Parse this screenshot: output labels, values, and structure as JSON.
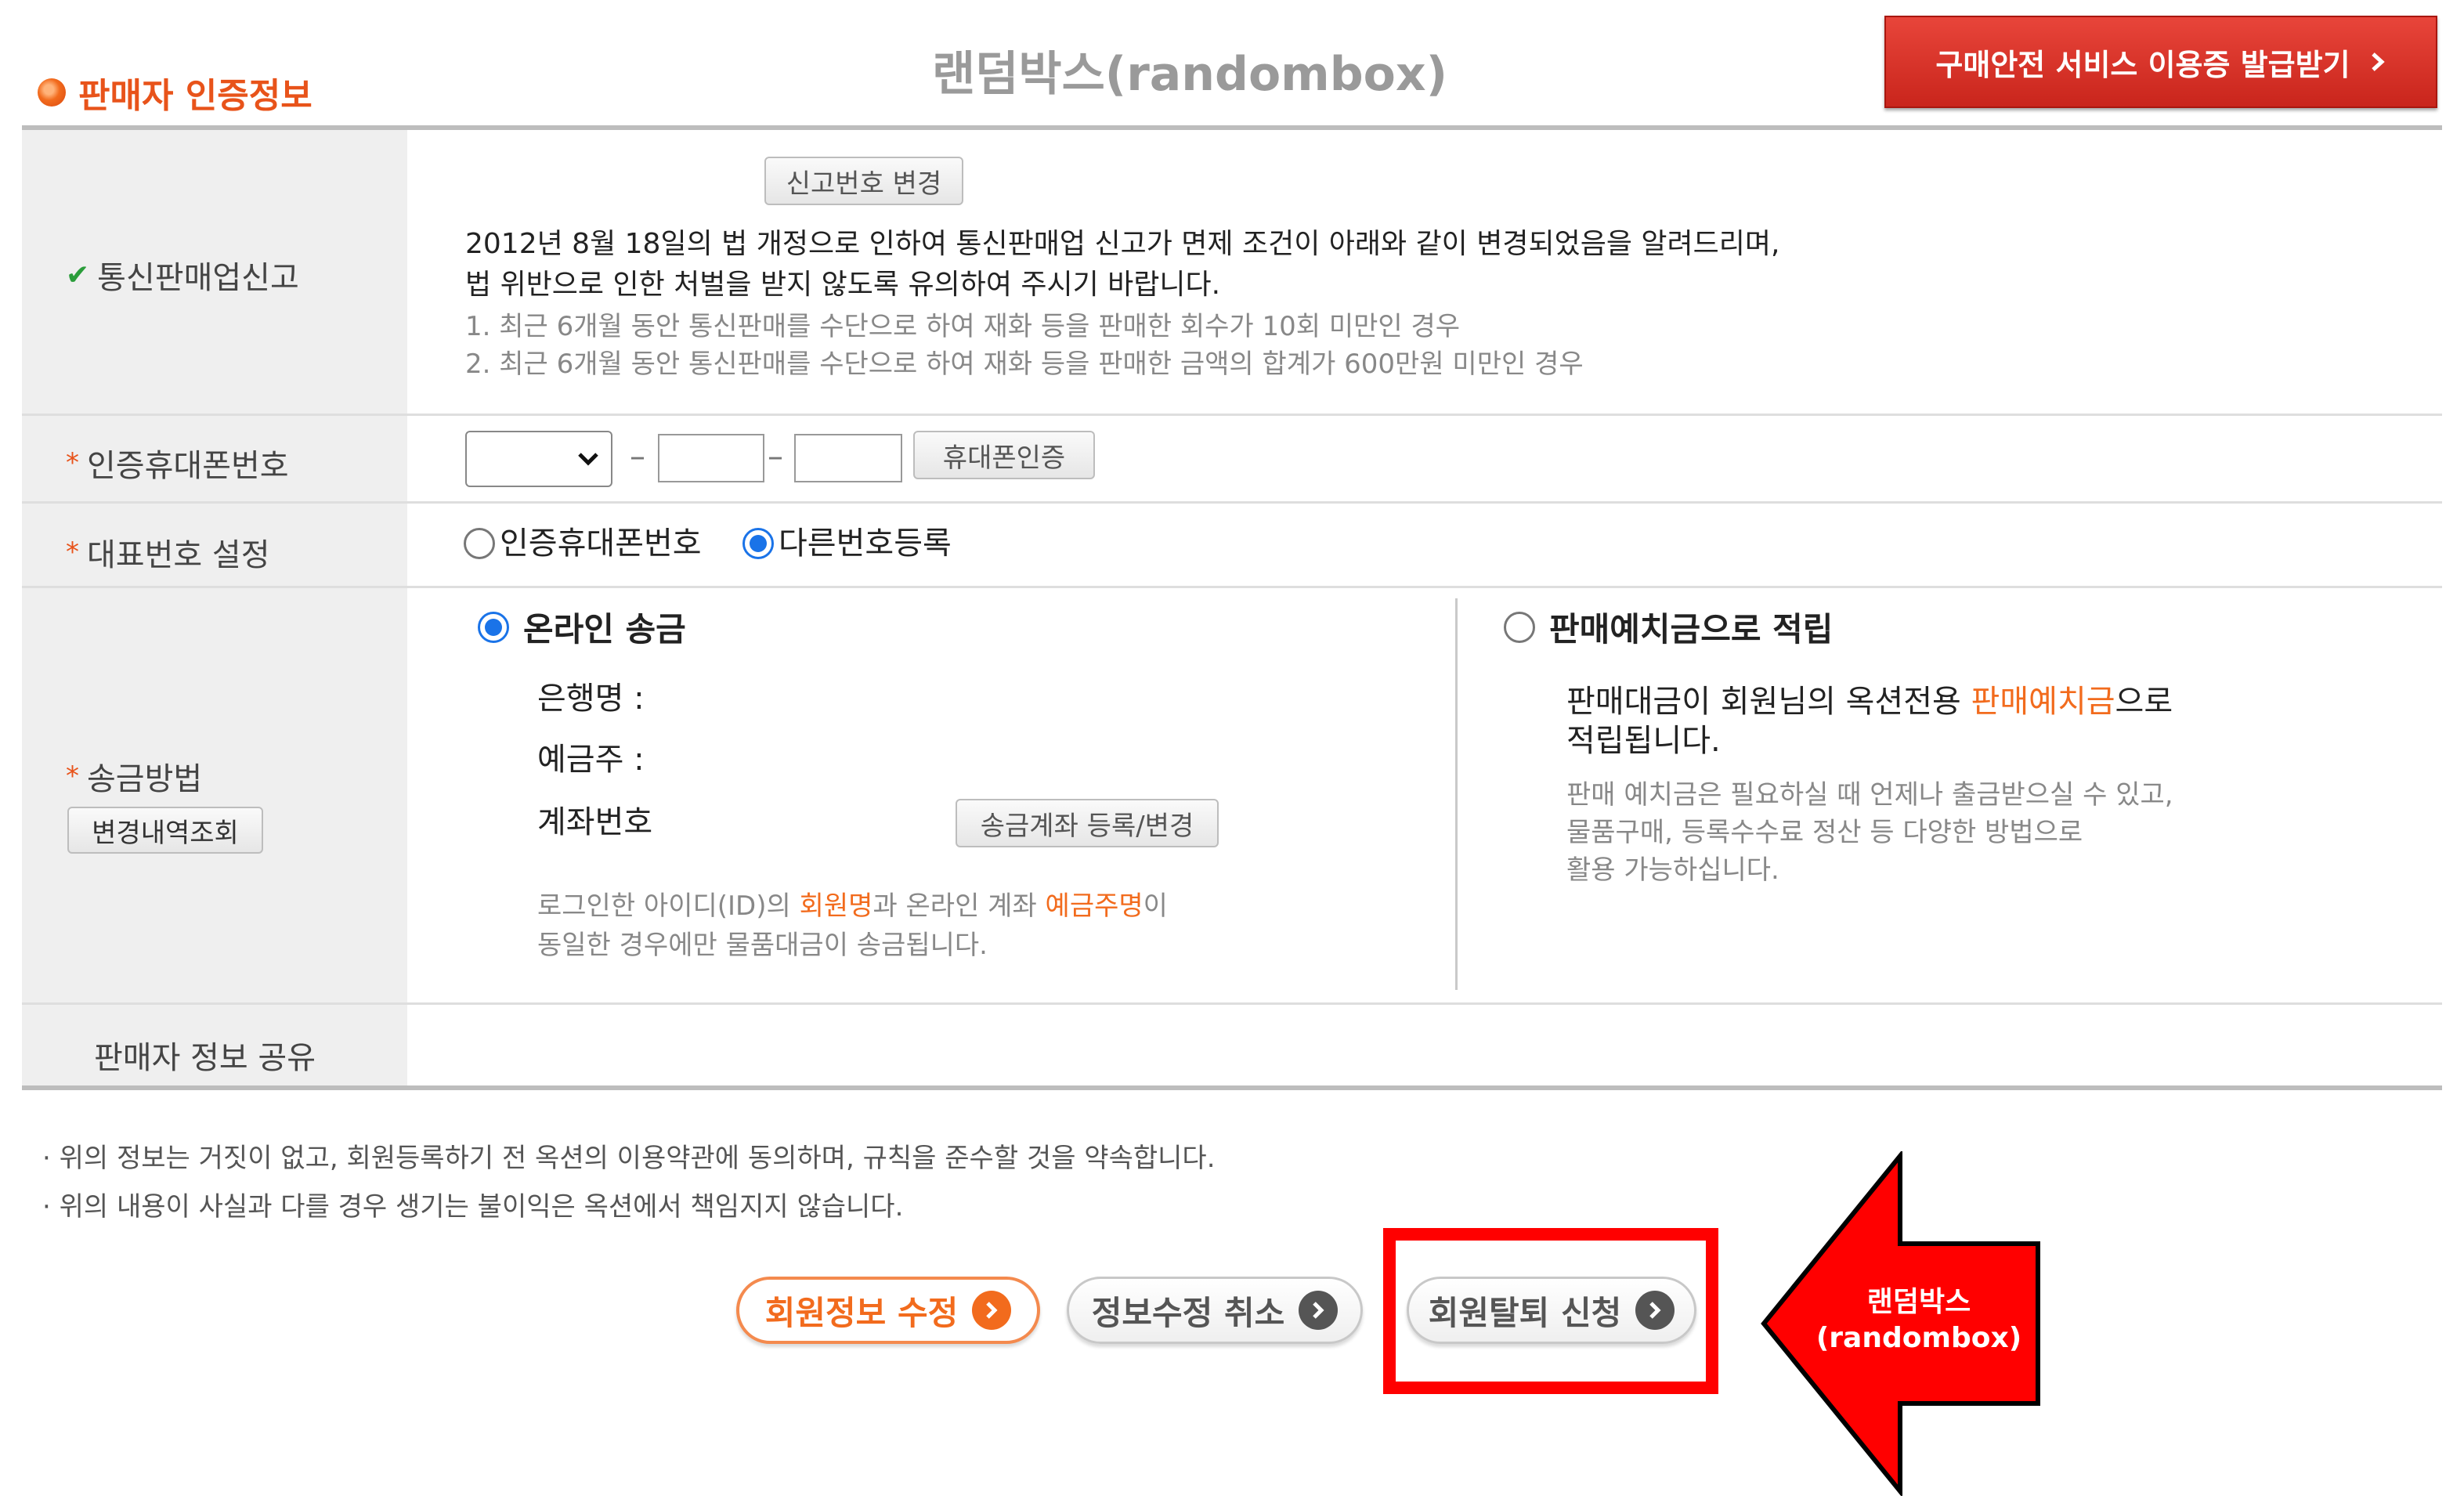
{
  "header": {
    "section_title": "판매자 인증정보",
    "watermark": "랜덤박스(randombox)",
    "purchase_safety_button": "구매안전 서비스 이용증 발급받기"
  },
  "rows": {
    "telecom": {
      "label": "통신판매업신고",
      "change_button": "신고번호 변경",
      "notice_line1": "2012년 8월 18일의 법 개정으로 인하여 통신판매업 신고가 면제 조건이 아래와 같이 변경되었음을 알려드리며,",
      "notice_line2": "법 위반으로 인한 처벌을 받지 않도록 유의하여 주시기 바랍니다.",
      "condition1": "1. 최근 6개월 동안 통신판매를 수단으로 하여 재화 등을 판매한 회수가 10회 미만인 경우",
      "condition2": "2. 최근 6개월 동안 통신판매를 수단으로 하여 재화 등을 판매한 금액의 합계가 600만원 미만인 경우"
    },
    "phone": {
      "label": "인증휴대폰번호",
      "separator": "–",
      "verify_button": "휴대폰인증",
      "select_value": ""
    },
    "rep_number": {
      "label": "대표번호 설정",
      "option1": "인증휴대폰번호",
      "option2": "다른번호등록"
    },
    "remit": {
      "label": "송금방법",
      "history_button": "변경내역조회",
      "online_option": "온라인 송금",
      "bank_label": "은행명 :",
      "holder_label": "예금주 :",
      "account_label": "계좌번호",
      "register_button": "송금계좌 등록/변경",
      "note_a": "로그인한 아이디(ID)의 ",
      "note_b": "회원명",
      "note_c": "과 온라인 계좌 ",
      "note_d": "예금주명",
      "note_e": "이",
      "note_line2": "동일한 경우에만 물품대금이 송금됩니다.",
      "deposit_option": "판매예치금으로 적립",
      "deposit_a": "판매대금이 회원님의 옥션전용 ",
      "deposit_b": "판매예치금",
      "deposit_c": "으로",
      "deposit_line2": "적립됩니다.",
      "deposit_note1": "판매 예치금은 필요하실 때 언제나 출금받으실 수 있고,",
      "deposit_note2": "물품구매, 등록수수료 정산 등 다양한 방법으로",
      "deposit_note3": "활용 가능하십니다."
    },
    "share": {
      "label": "판매자 정보 공유"
    }
  },
  "footer_notes": [
    "위의 정보는 거짓이 없고, 회원등록하기 전 옥션의 이용약관에 동의하며, 규칙을 준수할 것을 약속합니다.",
    "위의 내용이 사실과 다를 경우 생기는 불이익은 옥션에서 책임지지 않습니다."
  ],
  "buttons": {
    "modify": "회원정보 수정",
    "cancel": "정보수정 취소",
    "withdraw": "회원탈퇴 신청"
  },
  "annotation": {
    "line1": "랜덤박스",
    "line2": "(randombox)"
  },
  "colors": {
    "accent": "#f26b1d",
    "highlight": "#ff0000",
    "radio_selected": "#1a73e8",
    "checkmark": "#2a9d3a"
  }
}
